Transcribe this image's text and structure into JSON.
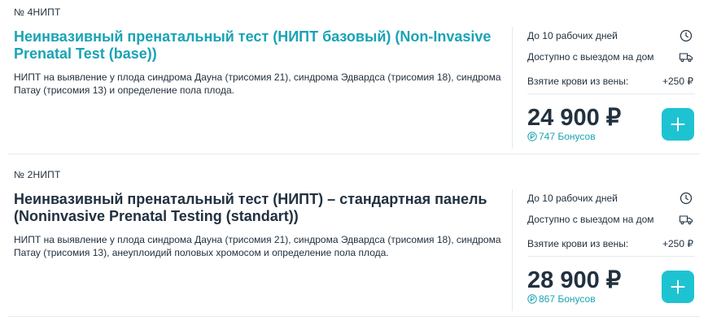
{
  "items": [
    {
      "code": "№ 4НИПТ",
      "title": "Неинвазивный пренатальный тест (НИПТ базовый) (Non-Invasive Prenatal Test (base))",
      "description": "НИПТ на выявление у плода синдрома Дауна (трисомия 21), синдрома Эдвардса (трисомия 18), синдрома Патау (трисомия 13) и определение пола плода.",
      "duration": "До 10 рабочих дней",
      "home_visit": "Доступно с выездом на дом",
      "blood_draw_label": "Взятие крови из вены:",
      "blood_draw_price": "+250 ₽",
      "price": "24 900 ₽",
      "bonus": "747 Бонусов"
    },
    {
      "code": "№ 2НИПТ",
      "title": "Неинвазивный пренатальный тест (НИПТ) – стандартная панель (Noninvasive Prenatal Testing (standart))",
      "description": "НИПТ на выявление у плода синдрома Дауна (трисомия 21), синдрома Эдвардса (трисомия 18), синдрома Патау (трисомия 13), анеуплоидий половых хромосом и определение пола плода.",
      "duration": "До 10 рабочих дней",
      "home_visit": "Доступно с выездом на дом",
      "blood_draw_label": "Взятие крови из вены:",
      "blood_draw_price": "+250 ₽",
      "price": "28 900 ₽",
      "bonus": "867 Бонусов"
    }
  ],
  "icons": {
    "duration": "clock-icon",
    "home_visit": "truck-icon",
    "bonus": "bonus-coin-icon",
    "add": "plus-icon"
  },
  "colors": {
    "accent": "#1aa3b5",
    "button": "#1ec3d2",
    "text": "#22313f",
    "divider": "#e6eaee"
  }
}
